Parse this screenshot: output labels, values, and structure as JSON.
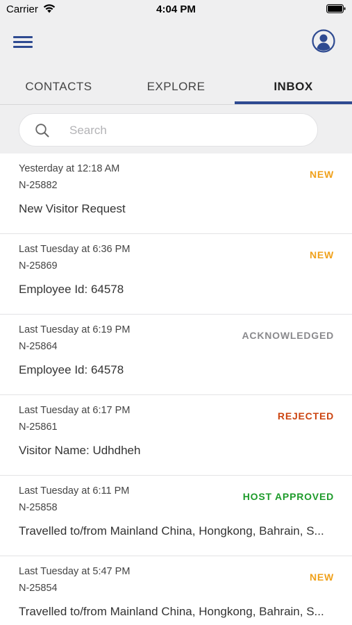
{
  "status_bar": {
    "carrier": "Carrier",
    "time": "4:04 PM"
  },
  "header": {
    "menu_icon": "hamburger-menu-icon",
    "profile_icon": "user-profile-icon",
    "accent_color": "#2e4a91"
  },
  "tabs": [
    {
      "label": "CONTACTS",
      "active": false
    },
    {
      "label": "EXPLORE",
      "active": false
    },
    {
      "label": "INBOX",
      "active": true
    }
  ],
  "search": {
    "placeholder": "Search",
    "value": ""
  },
  "status_colors": {
    "NEW": "#f0a11b",
    "ACKNOWLEDGED": "#8a8a8d",
    "REJECTED": "#cc4410",
    "HOST APPROVED": "#1d9b2a"
  },
  "inbox": [
    {
      "timestamp": "Yesterday at 12:18 AM",
      "ref": "N-25882",
      "title": "New Visitor Request",
      "status": "NEW"
    },
    {
      "timestamp": "Last Tuesday at 6:36 PM",
      "ref": "N-25869",
      "title": "Employee Id: 64578",
      "status": "NEW"
    },
    {
      "timestamp": "Last Tuesday at 6:19 PM",
      "ref": "N-25864",
      "title": "Employee Id: 64578",
      "status": "ACKNOWLEDGED"
    },
    {
      "timestamp": "Last Tuesday at 6:17 PM",
      "ref": "N-25861",
      "title": "Visitor Name: Udhdheh",
      "status": "REJECTED"
    },
    {
      "timestamp": "Last Tuesday at 6:11 PM",
      "ref": "N-25858",
      "title": "Travelled to/from Mainland China, Hongkong, Bahrain, S...",
      "status": "HOST APPROVED"
    },
    {
      "timestamp": "Last Tuesday at 5:47 PM",
      "ref": "N-25854",
      "title": "Travelled to/from Mainland China, Hongkong, Bahrain, S...",
      "status": "NEW"
    }
  ]
}
